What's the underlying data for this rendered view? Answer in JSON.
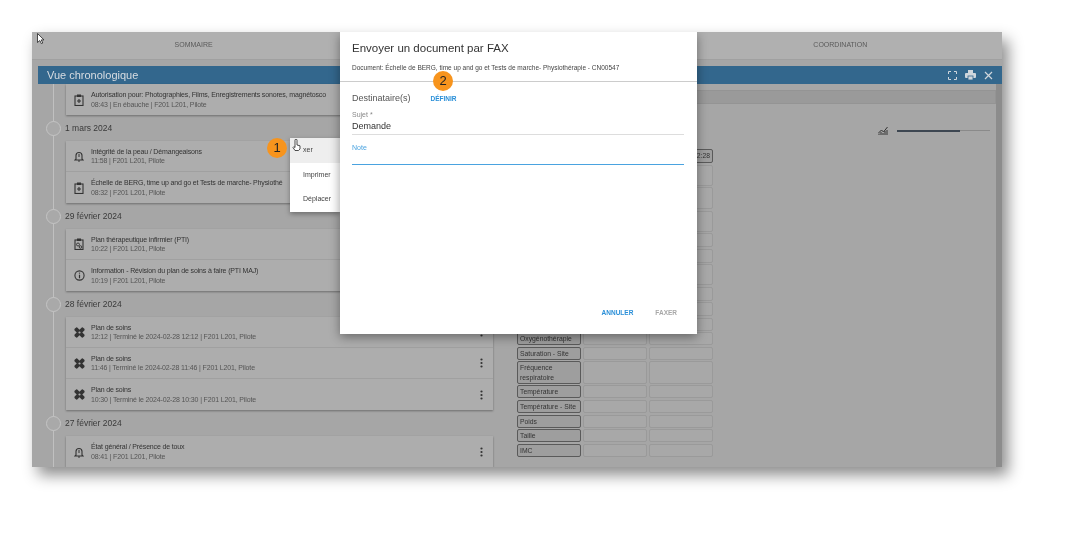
{
  "top_tabs": [
    {
      "label": "SOMMAIRE"
    },
    {
      "label": "COORDINATION"
    }
  ],
  "panel": {
    "title": "Vue chronologique"
  },
  "timeline": [
    {
      "entries": [
        {
          "kind": "consent",
          "title": "Autorisation pour: Photographies, Films, Enregistrements sonores, magnétosco",
          "detail": "08:43 | En ébauche | F201 L201, Pilote"
        }
      ]
    },
    {
      "date": "1 mars 2024",
      "entries": [
        {
          "kind": "alert",
          "title": "Intégrité de la peau / Démangeaisons",
          "detail": "11:58 | F201 L201, Pilote"
        },
        {
          "kind": "consent",
          "title": "Échelle de BERG, time up and go et Tests de marche- Physiothé",
          "detail": "08:32 | F201 L201, Pilote"
        }
      ]
    },
    {
      "date": "29 février 2024",
      "entries": [
        {
          "kind": "plan",
          "title": "Plan thérapeutique infirmier (PTI)",
          "detail": "10:22 | F201 L201, Pilote"
        },
        {
          "kind": "info",
          "title": "Information - Révision du plan de soins à faire (PTI MAJ)",
          "detail": "10:19 | F201 L201, Pilote"
        }
      ]
    },
    {
      "date": "28 février 2024",
      "entries": [
        {
          "kind": "care",
          "title": "Plan de soins",
          "detail": "12:12 | Terminé le 2024-02-28 12:12 | F201 L201, Pilote",
          "has_menu": true
        },
        {
          "kind": "care",
          "title": "Plan de soins",
          "detail": "11:46 | Terminé le 2024-02-28 11:46 | F201 L201, Pilote",
          "has_menu": true
        },
        {
          "kind": "care",
          "title": "Plan de soins",
          "detail": "10:30 | Terminé le 2024-02-28 10:30 | F201 L201, Pilote",
          "has_menu": true
        }
      ]
    },
    {
      "date": "27 février 2024",
      "entries": [
        {
          "kind": "alert",
          "title": "État général / Présence de toux",
          "detail": "08:41 | F201 L201, Pilote",
          "has_menu": true
        }
      ]
    }
  ],
  "context_menu": [
    {
      "label": "xer",
      "selected": true
    },
    {
      "label": "Imprimer",
      "selected": false
    },
    {
      "label": "Déplacer",
      "selected": false
    }
  ],
  "slider": {
    "level": 0.68
  },
  "vitals": {
    "header_time": "2:28",
    "rows": [
      {
        "label": "Oxygénothérapie"
      },
      {
        "label": "Saturation - Site"
      },
      {
        "label": "Fréquence respiratoire"
      },
      {
        "label": "Température"
      },
      {
        "label": "Température - Site"
      },
      {
        "label": "Poids"
      },
      {
        "label": "Taille"
      },
      {
        "label": "IMC"
      }
    ]
  },
  "dialog": {
    "title": "Envoyer un document par FAX",
    "document": "Document: Échelle de BERG, time up and go et Tests de marche- Physiothérapie - CN00547",
    "recipients_label": "Destinataire(s)",
    "define_link": "DÉFINIR",
    "subject": {
      "label": "Sujet *",
      "value": "Demande"
    },
    "note": {
      "label": "Note"
    },
    "buttons": [
      {
        "label": "ANNULER",
        "disabled": false
      },
      {
        "label": "FAXER",
        "disabled": true
      }
    ]
  },
  "callouts": [
    "1",
    "2"
  ]
}
